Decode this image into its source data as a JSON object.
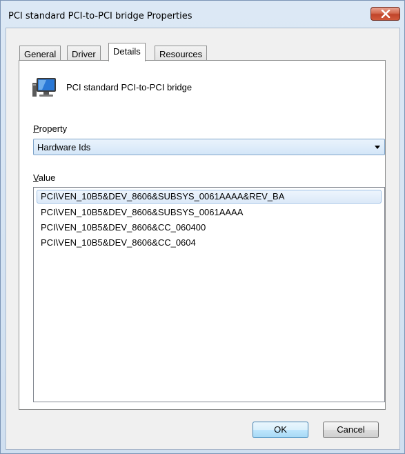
{
  "window": {
    "title": "PCI standard PCI-to-PCI bridge Properties"
  },
  "tabs": [
    {
      "label": "General"
    },
    {
      "label": "Driver"
    },
    {
      "label": "Details"
    },
    {
      "label": "Resources"
    }
  ],
  "details": {
    "device_name": "PCI standard PCI-to-PCI bridge",
    "device_icon": "monitor-icon",
    "property_label": "Property",
    "property_label_accel": "P",
    "property_label_rest": "roperty",
    "property_value": "Hardware Ids",
    "value_label": "Value",
    "value_label_accel": "V",
    "value_label_rest": "alue",
    "values": [
      "PCI\\VEN_10B5&DEV_8606&SUBSYS_0061AAAA&REV_BA",
      "PCI\\VEN_10B5&DEV_8606&SUBSYS_0061AAAA",
      "PCI\\VEN_10B5&DEV_8606&CC_060400",
      "PCI\\VEN_10B5&DEV_8606&CC_0604"
    ]
  },
  "buttons": {
    "ok_label": "OK",
    "cancel_label": "Cancel"
  },
  "colors": {
    "title_bar": "#dbe6f3",
    "close_button": "#c0442a",
    "selection": "#dce9f8"
  }
}
